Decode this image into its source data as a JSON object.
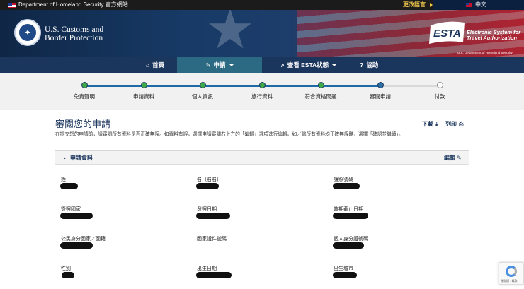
{
  "topbar": {
    "gov_text": "Department of Homeland Security 官方網站",
    "change_language": "更改語言",
    "current_language": "中文"
  },
  "header": {
    "agency_line1": "U.S. Customs and",
    "agency_line2": "Border Protection",
    "esta_logo_text": "ESTA",
    "esta_full_line1": "Electronic System for",
    "esta_full_line2": "Travel Authorization",
    "esta_sub": "U.S. Department of Homeland Security"
  },
  "nav": {
    "home": "首頁",
    "apply": "申請",
    "check_status": "查看 ESTA狀態",
    "help": "協助"
  },
  "progress": {
    "steps": [
      "免責聲明",
      "申請資料",
      "個人資訊",
      "旅行資料",
      "符合資格問題",
      "審閱申請",
      "付款"
    ],
    "current_index": 5
  },
  "page": {
    "title": "審閱您的申請",
    "description": "在提交您的申請前，請審閱所有資料是否正確無誤。如資料有誤，選擇申請審閱右上方的「編輯」選項進行編輯。如／當所有資料均正確無誤時，選擇「確認並繼續」。",
    "download": "下載",
    "print": "列印"
  },
  "panel": {
    "title": "申請資料",
    "edit": "編輯",
    "fields": [
      {
        "label": "姓"
      },
      {
        "label": "名（名名）"
      },
      {
        "label": "護照號碼"
      },
      {
        "label": "簽照國家"
      },
      {
        "label": "發照日期"
      },
      {
        "label": "效期截止日期"
      },
      {
        "label": "公民身分國家／國籍"
      },
      {
        "label": "國家證件號碼"
      },
      {
        "label": "個人身分證號碼"
      },
      {
        "label": "性別"
      },
      {
        "label": "出生日期"
      },
      {
        "label": "出生城市"
      }
    ]
  },
  "recaptcha": {
    "text": "隱私權 - 條款"
  },
  "colors": {
    "navy": "#1b365d",
    "nav_active": "#2b6a82",
    "step_done": "#3fa84a",
    "progress_blue": "#1e6aa7",
    "lang_gold": "#f2c94c"
  }
}
